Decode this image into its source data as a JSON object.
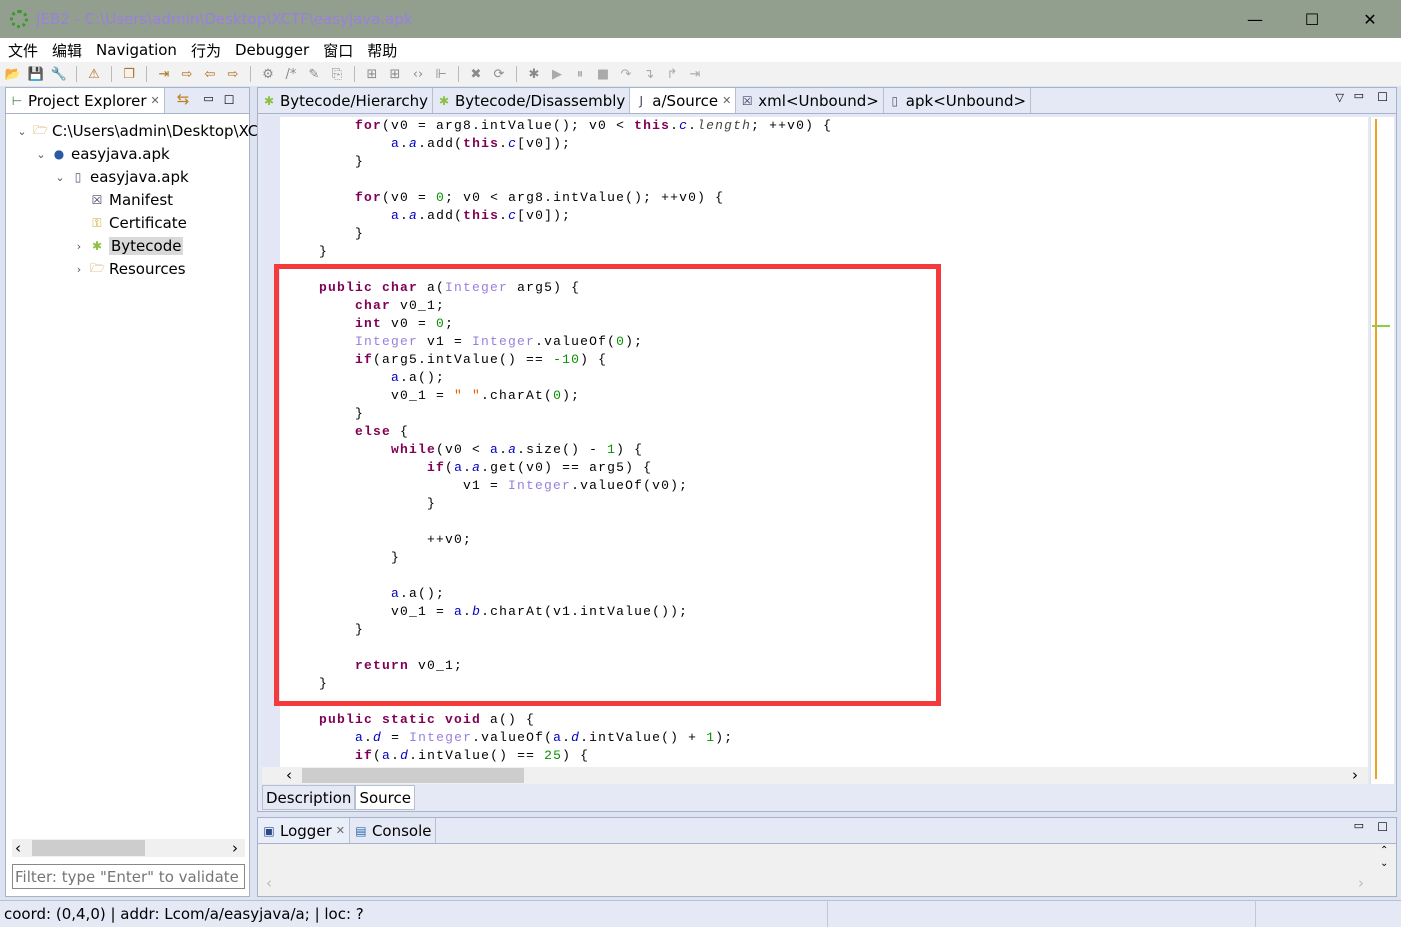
{
  "window": {
    "title": "JEB2 - C:\\Users\\admin\\Desktop\\XCTF\\easyjava.apk",
    "minimize": "—",
    "maximize": "☐",
    "close": "✕"
  },
  "menu": [
    "文件",
    "编辑",
    "Navigation",
    "行为",
    "Debugger",
    "窗口",
    "帮助"
  ],
  "toolbar_icons": [
    "open-folder",
    "save",
    "wrench",
    "warning",
    "new-window",
    "jump-to",
    "navigate",
    "back",
    "forward",
    "options",
    "comment",
    "rename",
    "export",
    "grid",
    "grid-alt",
    "code",
    "tree-nodes",
    "delete",
    "refresh",
    "debug-bug",
    "run",
    "pause",
    "stop",
    "step-over",
    "step-into",
    "step-out",
    "run-to"
  ],
  "left_panel": {
    "tab": "Project Explorer",
    "tree": [
      {
        "label": "C:\\Users\\admin\\Desktop\\XCTF",
        "icon": "folder-icon",
        "depth": 0,
        "expanded": true
      },
      {
        "label": "easyjava.apk",
        "icon": "artifact-icon",
        "depth": 1,
        "expanded": true
      },
      {
        "label": "easyjava.apk",
        "icon": "apk-icon",
        "depth": 2,
        "expanded": true
      },
      {
        "label": "Manifest",
        "icon": "xml-icon",
        "depth": 3
      },
      {
        "label": "Certificate",
        "icon": "key-icon",
        "depth": 3
      },
      {
        "label": "Bytecode",
        "icon": "android-icon",
        "depth": 3,
        "collapsed": true,
        "selected": true
      },
      {
        "label": "Resources",
        "icon": "folder-icon",
        "depth": 3,
        "collapsed": true
      }
    ],
    "filter_placeholder": "Filter: type \"Enter\" to validate"
  },
  "editor": {
    "tabs": [
      {
        "label": "Bytecode/Hierarchy",
        "icon": "android-icon"
      },
      {
        "label": "Bytecode/Disassembly",
        "icon": "android-icon"
      },
      {
        "label": "a/Source",
        "icon": "java-file-icon",
        "active": true,
        "closable": true
      },
      {
        "label": "xml<Unbound>",
        "icon": "xml-icon"
      },
      {
        "label": "apk<Unbound>",
        "icon": "apk-icon"
      }
    ],
    "code": [
      [
        [
          "p",
          "        "
        ],
        [
          "k",
          "for"
        ],
        [
          "p",
          "(v0 = arg8.intValue(); v0 < "
        ],
        [
          "k",
          "this"
        ],
        [
          "p",
          "."
        ],
        [
          "i",
          "c"
        ],
        [
          "p",
          "."
        ],
        [
          "ti",
          "length"
        ],
        [
          "p",
          "; ++v0) {"
        ]
      ],
      [
        [
          "p",
          "            "
        ],
        [
          "f",
          "a"
        ],
        [
          "p",
          "."
        ],
        [
          "i",
          "a"
        ],
        [
          "p",
          ".add("
        ],
        [
          "k",
          "this"
        ],
        [
          "p",
          "."
        ],
        [
          "i",
          "c"
        ],
        [
          "p",
          "[v0]);"
        ]
      ],
      [
        [
          "p",
          "        }"
        ]
      ],
      [],
      [
        [
          "p",
          "        "
        ],
        [
          "k",
          "for"
        ],
        [
          "p",
          "(v0 = "
        ],
        [
          "n",
          "0"
        ],
        [
          "p",
          "; v0 < arg8.intValue(); ++v0) {"
        ]
      ],
      [
        [
          "p",
          "            "
        ],
        [
          "f",
          "a"
        ],
        [
          "p",
          "."
        ],
        [
          "i",
          "a"
        ],
        [
          "p",
          ".add("
        ],
        [
          "k",
          "this"
        ],
        [
          "p",
          "."
        ],
        [
          "i",
          "c"
        ],
        [
          "p",
          "[v0]);"
        ]
      ],
      [
        [
          "p",
          "        }"
        ]
      ],
      [
        [
          "p",
          "    }"
        ]
      ],
      [],
      [
        [
          "p",
          "    "
        ],
        [
          "k",
          "public char"
        ],
        [
          "p",
          " a("
        ],
        [
          "t",
          "Integer"
        ],
        [
          "p",
          " arg5) {"
        ]
      ],
      [
        [
          "p",
          "        "
        ],
        [
          "k",
          "char"
        ],
        [
          "p",
          " v0_1;"
        ]
      ],
      [
        [
          "p",
          "        "
        ],
        [
          "k",
          "int"
        ],
        [
          "p",
          " v0 = "
        ],
        [
          "n",
          "0"
        ],
        [
          "p",
          ";"
        ]
      ],
      [
        [
          "p",
          "        "
        ],
        [
          "t",
          "Integer"
        ],
        [
          "p",
          " v1 = "
        ],
        [
          "t",
          "Integer"
        ],
        [
          "p",
          ".valueOf("
        ],
        [
          "n",
          "0"
        ],
        [
          "p",
          ");"
        ]
      ],
      [
        [
          "p",
          "        "
        ],
        [
          "k",
          "if"
        ],
        [
          "p",
          "(arg5.intValue() == "
        ],
        [
          "n",
          "-10"
        ],
        [
          "p",
          ") {"
        ]
      ],
      [
        [
          "p",
          "            "
        ],
        [
          "f",
          "a"
        ],
        [
          "p",
          ".a();"
        ]
      ],
      [
        [
          "p",
          "            v0_1 = "
        ],
        [
          "s",
          "\" \""
        ],
        [
          "p",
          ".charAt("
        ],
        [
          "n",
          "0"
        ],
        [
          "p",
          ");"
        ]
      ],
      [
        [
          "p",
          "        }"
        ]
      ],
      [
        [
          "p",
          "        "
        ],
        [
          "k",
          "else"
        ],
        [
          "p",
          " {"
        ]
      ],
      [
        [
          "p",
          "            "
        ],
        [
          "k",
          "while"
        ],
        [
          "p",
          "(v0 < "
        ],
        [
          "f",
          "a"
        ],
        [
          "p",
          "."
        ],
        [
          "i",
          "a"
        ],
        [
          "p",
          ".size() - "
        ],
        [
          "n",
          "1"
        ],
        [
          "p",
          ") {"
        ]
      ],
      [
        [
          "p",
          "                "
        ],
        [
          "k",
          "if"
        ],
        [
          "p",
          "("
        ],
        [
          "f",
          "a"
        ],
        [
          "p",
          "."
        ],
        [
          "i",
          "a"
        ],
        [
          "p",
          ".get(v0) == arg5) {"
        ]
      ],
      [
        [
          "p",
          "                    v1 = "
        ],
        [
          "t",
          "Integer"
        ],
        [
          "p",
          ".valueOf(v0);"
        ]
      ],
      [
        [
          "p",
          "                }"
        ]
      ],
      [],
      [
        [
          "p",
          "                ++v0;"
        ]
      ],
      [
        [
          "p",
          "            }"
        ]
      ],
      [],
      [
        [
          "p",
          "            "
        ],
        [
          "f",
          "a"
        ],
        [
          "p",
          ".a();"
        ]
      ],
      [
        [
          "p",
          "            v0_1 = "
        ],
        [
          "f",
          "a"
        ],
        [
          "p",
          "."
        ],
        [
          "i",
          "b"
        ],
        [
          "p",
          ".charAt(v1.intValue());"
        ]
      ],
      [
        [
          "p",
          "        }"
        ]
      ],
      [],
      [
        [
          "p",
          "        "
        ],
        [
          "k",
          "return"
        ],
        [
          "p",
          " v0_1;"
        ]
      ],
      [
        [
          "p",
          "    }"
        ]
      ],
      [],
      [
        [
          "p",
          "    "
        ],
        [
          "k",
          "public static void"
        ],
        [
          "p",
          " a() {"
        ]
      ],
      [
        [
          "p",
          "        "
        ],
        [
          "f",
          "a"
        ],
        [
          "p",
          "."
        ],
        [
          "i",
          "d"
        ],
        [
          "p",
          " = "
        ],
        [
          "t",
          "Integer"
        ],
        [
          "p",
          ".valueOf("
        ],
        [
          "f",
          "a"
        ],
        [
          "p",
          "."
        ],
        [
          "i",
          "d"
        ],
        [
          "p",
          ".intValue() + "
        ],
        [
          "n",
          "1"
        ],
        [
          "p",
          ");"
        ]
      ],
      [
        [
          "p",
          "        "
        ],
        [
          "k",
          "if"
        ],
        [
          "p",
          "("
        ],
        [
          "f",
          "a"
        ],
        [
          "p",
          "."
        ],
        [
          "i",
          "d"
        ],
        [
          "p",
          ".intValue() == "
        ],
        [
          "n",
          "25"
        ],
        [
          "p",
          ") {"
        ]
      ]
    ],
    "sub_tabs": [
      "Description",
      "Source"
    ],
    "highlight_color": "#f43a3a"
  },
  "bottom_panel": {
    "tabs": [
      "Logger",
      "Console"
    ]
  },
  "status": {
    "text": "coord: (0,4,0) | addr: Lcom/a/easyjava/a; | loc: ?"
  }
}
